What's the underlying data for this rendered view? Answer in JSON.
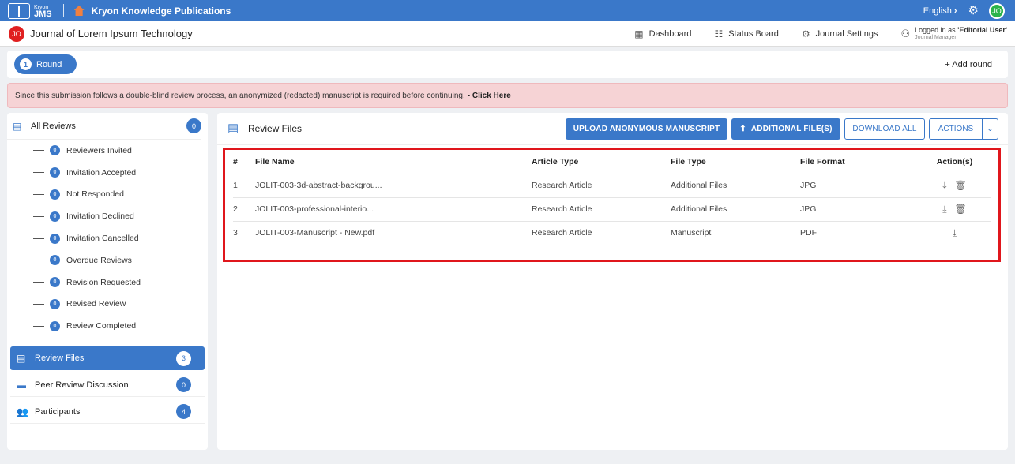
{
  "topbar": {
    "logo_small": "Kryon",
    "logo_big": "JMS",
    "publication": "Kryon Knowledge Publications",
    "language": "English",
    "user_initials": "JO"
  },
  "journal": {
    "initials": "JO",
    "title": "Journal of Lorem Ipsum Technology",
    "nav": [
      {
        "label": "Dashboard",
        "icon": "grid-icon"
      },
      {
        "label": "Status Board",
        "icon": "board-icon"
      },
      {
        "label": "Journal Settings",
        "icon": "settings-icon"
      }
    ],
    "logged_in_prefix": "Logged in as",
    "logged_in_user": "'Editorial User'",
    "role": "Journal Manager"
  },
  "round": {
    "number": "1",
    "label": "Round",
    "add_label": "+ Add round"
  },
  "alert": {
    "text": "Since this submission follows a double-blind review process, an anonymized (redacted) manuscript is required before continuing.",
    "link": "- Click Here"
  },
  "sidebar": {
    "all_reviews": {
      "label": "All Reviews",
      "count": "0"
    },
    "tree": [
      {
        "label": "Reviewers Invited",
        "count": "0"
      },
      {
        "label": "Invitation Accepted",
        "count": "0"
      },
      {
        "label": "Not Responded",
        "count": "0"
      },
      {
        "label": "Invitation Declined",
        "count": "0"
      },
      {
        "label": "Invitation Cancelled",
        "count": "0"
      },
      {
        "label": "Overdue Reviews",
        "count": "0"
      },
      {
        "label": "Revision Requested",
        "count": "0"
      },
      {
        "label": "Revised Review",
        "count": "0"
      },
      {
        "label": "Review Completed",
        "count": "0"
      }
    ],
    "items": [
      {
        "label": "Review Files",
        "count": "3"
      },
      {
        "label": "Peer Review Discussion",
        "count": "0"
      },
      {
        "label": "Participants",
        "count": "4"
      }
    ]
  },
  "main": {
    "title": "Review Files",
    "buttons": {
      "upload": "UPLOAD ANONYMOUS MANUSCRIPT",
      "additional": "ADDITIONAL FILE(S)",
      "download_all": "DOWNLOAD ALL",
      "actions": "ACTIONS"
    },
    "columns": [
      "#",
      "File Name",
      "Article Type",
      "File Type",
      "File Format",
      "Action(s)"
    ],
    "rows": [
      {
        "num": "1",
        "name": "JOLIT-003-3d-abstract-backgrou...",
        "article": "Research Article",
        "type": "Additional Files",
        "format": "JPG"
      },
      {
        "num": "2",
        "name": "JOLIT-003-professional-interio...",
        "article": "Research Article",
        "type": "Additional Files",
        "format": "JPG"
      },
      {
        "num": "3",
        "name": "JOLIT-003-Manuscript - New.pdf",
        "article": "Research Article",
        "type": "Manuscript",
        "format": "PDF"
      }
    ]
  }
}
